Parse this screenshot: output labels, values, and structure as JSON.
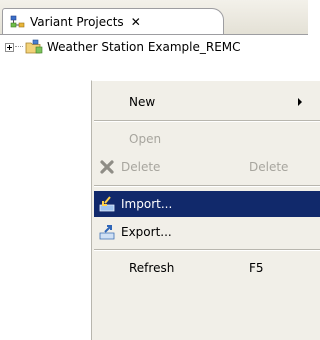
{
  "view": {
    "tab_title": "Variant Projects",
    "tab_icon": "variant-projects-icon",
    "close_icon": "close-icon"
  },
  "tree": {
    "root_label": "Weather Station Example_REMC",
    "root_icon": "project-folder-icon",
    "expanded": false
  },
  "context_menu": {
    "items": [
      {
        "label": "New",
        "shortcut": "",
        "enabled": true,
        "submenu": true,
        "icon": ""
      },
      {
        "label": "Open",
        "shortcut": "",
        "enabled": false,
        "icon": ""
      },
      {
        "label": "Delete",
        "shortcut": "Delete",
        "enabled": false,
        "icon": "delete-icon"
      },
      {
        "label": "Import...",
        "shortcut": "",
        "enabled": true,
        "selected": true,
        "icon": "import-icon"
      },
      {
        "label": "Export...",
        "shortcut": "",
        "enabled": true,
        "icon": "export-icon"
      },
      {
        "label": "Refresh",
        "shortcut": "F5",
        "enabled": true,
        "icon": ""
      }
    ]
  },
  "colors": {
    "selection": "#11296b",
    "menu_background": "#f1efe8",
    "disabled_text": "#a7a59e"
  }
}
